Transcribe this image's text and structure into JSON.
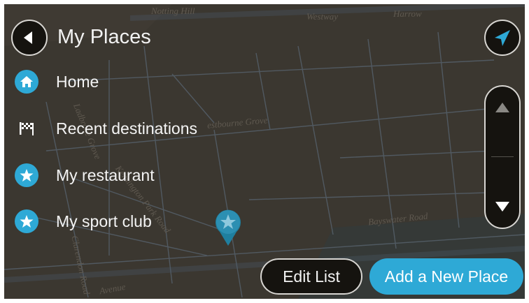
{
  "header": {
    "title": "My Places",
    "back_icon": "back-arrow-icon",
    "locate_icon": "navigation-arrow-icon"
  },
  "map": {
    "labels": {
      "notting_hill": "Notting Hill",
      "westway": "Westway",
      "harrow": "Harrow",
      "westbourne_grove": "estbourne Grove",
      "kensington_park_road": "Kensington Park Road",
      "ladbroke_grove": "Ladbroke Grove",
      "clarendon_road": "Clarendon Road",
      "bayswater_road": "Bayswater Road",
      "avenue": "Avenue"
    },
    "pin_icon": "favorite-star-pin-icon"
  },
  "places": {
    "items": [
      {
        "label": "Home",
        "icon": "home-icon"
      },
      {
        "label": "Recent destinations",
        "icon": "checkered-flag-icon"
      },
      {
        "label": "My restaurant",
        "icon": "star-icon"
      },
      {
        "label": "My sport club",
        "icon": "star-icon"
      }
    ]
  },
  "scroll": {
    "up_icon": "scroll-up-icon",
    "down_icon": "scroll-down-icon"
  },
  "footer": {
    "edit_list_label": "Edit List",
    "add_place_label": "Add a New Place"
  },
  "colors": {
    "accent": "#2ea9d6",
    "map_background": "#3b3730",
    "button_dark": "#15130f"
  }
}
